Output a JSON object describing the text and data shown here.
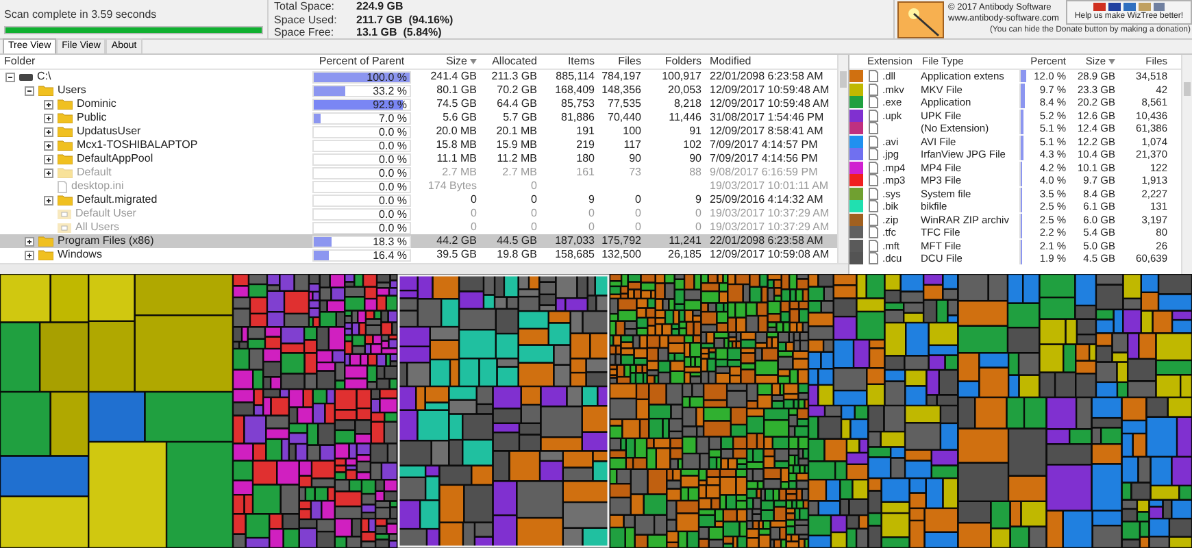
{
  "scan": {
    "status": "Scan complete in 3.59 seconds",
    "level": 1
  },
  "stats": [
    {
      "label": "Total Space:",
      "value": "224.9 GB"
    },
    {
      "label": "Space Used:",
      "value": "211.7 GB  (94.16%)"
    },
    {
      "label": "Space Free:",
      "value": "13.1 GB  (5.84%)"
    }
  ],
  "about": {
    "copyright": "© 2017 Antibody Software",
    "url": "www.antibody-software.com",
    "donate_caption": "Help us make WizTree better!",
    "donate_hint": "(You can hide the Donate button by making a donation)"
  },
  "tabs": [
    {
      "label": "Tree View",
      "selected": true
    },
    {
      "label": "File View",
      "selected": false
    },
    {
      "label": "About",
      "selected": false
    }
  ],
  "tree_columns": [
    {
      "label": "Folder",
      "sorted": false
    },
    {
      "label": "Percent of Parent",
      "sorted": false
    },
    {
      "label": "Size",
      "sorted": true
    },
    {
      "label": "Allocated",
      "sorted": false
    },
    {
      "label": "Items",
      "sorted": false
    },
    {
      "label": "Files",
      "sorted": false
    },
    {
      "label": "Folders",
      "sorted": false
    },
    {
      "label": "Modified",
      "sorted": false
    }
  ],
  "tree": [
    {
      "name": "C:\\",
      "kind": "drive",
      "expanded": true,
      "hidden": false,
      "selected": false,
      "percent": "100.0 %",
      "level": 1,
      "size": "241.4 GB",
      "allocated": "211.3 GB",
      "items": "885,114",
      "files": "784,197",
      "folders": "100,917",
      "modified": "22/01/2098 6:23:58 AM",
      "children": [
        {
          "name": "Users",
          "kind": "folder",
          "expanded": true,
          "hidden": false,
          "selected": false,
          "percent": "33.2 %",
          "level": 0.332,
          "size": "80.1 GB",
          "allocated": "70.2 GB",
          "items": "168,409",
          "files": "148,356",
          "folders": "20,053",
          "modified": "12/09/2017 10:59:48 AM",
          "children": [
            {
              "name": "Dominic",
              "kind": "folder",
              "expanded": false,
              "hidden": false,
              "selected": false,
              "percent": "92.9 %",
              "level": 0.929,
              "size": "74.5 GB",
              "allocated": "64.4 GB",
              "items": "85,753",
              "files": "77,535",
              "folders": "8,218",
              "modified": "12/09/2017 10:59:48 AM"
            },
            {
              "name": "Public",
              "kind": "folder",
              "expanded": false,
              "hidden": false,
              "selected": false,
              "percent": "7.0 %",
              "level": 0.07,
              "size": "5.6 GB",
              "allocated": "5.7 GB",
              "items": "81,886",
              "files": "70,440",
              "folders": "11,446",
              "modified": "31/08/2017 1:54:46 PM"
            },
            {
              "name": "UpdatusUser",
              "kind": "folder",
              "expanded": false,
              "hidden": false,
              "selected": false,
              "percent": "0.0 %",
              "size": "20.0 MB",
              "allocated": "20.1 MB",
              "items": "191",
              "files": "100",
              "folders": "91",
              "modified": "12/09/2017 8:58:41 AM"
            },
            {
              "name": "Mcx1-TOSHIBALAPTOP",
              "kind": "folder",
              "expanded": false,
              "hidden": false,
              "selected": false,
              "percent": "0.0 %",
              "size": "15.8 MB",
              "allocated": "15.9 MB",
              "items": "219",
              "files": "117",
              "folders": "102",
              "modified": "7/09/2017 4:14:57 PM"
            },
            {
              "name": "DefaultAppPool",
              "kind": "folder",
              "expanded": false,
              "hidden": false,
              "selected": false,
              "percent": "0.0 %",
              "size": "11.1 MB",
              "allocated": "11.2 MB",
              "items": "180",
              "files": "90",
              "folders": "90",
              "modified": "7/09/2017 4:14:56 PM"
            },
            {
              "name": "Default",
              "kind": "folder",
              "expanded": false,
              "hidden": true,
              "selected": false,
              "percent": "0.0 %",
              "size": "2.7 MB",
              "allocated": "2.7 MB",
              "items": "161",
              "files": "73",
              "folders": "88",
              "modified": "9/08/2017 6:16:59 PM"
            },
            {
              "name": "desktop.ini",
              "kind": "file",
              "hidden": true,
              "selected": false,
              "percent": "0.0 %",
              "size": "174 Bytes",
              "allocated": "0",
              "modified": "19/03/2017 10:01:11 AM"
            },
            {
              "name": "Default.migrated",
              "kind": "folder",
              "expanded": false,
              "hidden": false,
              "selected": false,
              "percent": "0.0 %",
              "size": "0",
              "allocated": "0",
              "items": "9",
              "files": "0",
              "folders": "9",
              "modified": "25/09/2016 4:14:32 AM"
            },
            {
              "name": "Default User",
              "kind": "link",
              "hidden": true,
              "selected": false,
              "percent": "0.0 %",
              "size": "0",
              "allocated": "0",
              "items": "0",
              "files": "0",
              "folders": "0",
              "modified": "19/03/2017 10:37:29 AM"
            },
            {
              "name": "All Users",
              "kind": "link",
              "hidden": true,
              "selected": false,
              "percent": "0.0 %",
              "size": "0",
              "allocated": "0",
              "items": "0",
              "files": "0",
              "folders": "0",
              "modified": "19/03/2017 10:37:29 AM"
            }
          ]
        },
        {
          "name": "Program Files (x86)",
          "kind": "folder",
          "expanded": false,
          "hidden": false,
          "selected": true,
          "percent": "18.3 %",
          "level": 0.183,
          "size": "44.2 GB",
          "allocated": "44.5 GB",
          "items": "187,033",
          "files": "175,792",
          "folders": "11,241",
          "modified": "22/01/2098 6:23:58 AM"
        },
        {
          "name": "Windows",
          "kind": "folder",
          "expanded": false,
          "hidden": false,
          "selected": false,
          "percent": "16.4 %",
          "level": 0.164,
          "size": "39.5 GB",
          "allocated": "19.8 GB",
          "items": "158,685",
          "files": "132,500",
          "folders": "26,185",
          "modified": "12/09/2017 10:59:08 AM"
        }
      ]
    }
  ],
  "ext_columns": [
    {
      "label": "Extension",
      "sorted": false
    },
    {
      "label": "File Type",
      "sorted": false
    },
    {
      "label": "Percent",
      "sorted": false
    },
    {
      "label": "Size",
      "sorted": true
    },
    {
      "label": "Files",
      "sorted": false
    }
  ],
  "extensions": [
    {
      "color": "#d07010",
      "ext": ".dll",
      "type": "Application extens",
      "percent": "12.0 %",
      "level": 0.12,
      "size": "28.9 GB",
      "files": "34,518"
    },
    {
      "color": "#c0b800",
      "ext": ".mkv",
      "type": "MKV File",
      "percent": "9.7 %",
      "level": 0.097,
      "size": "23.3 GB",
      "files": "42"
    },
    {
      "color": "#20a040",
      "ext": ".exe",
      "type": "Application",
      "percent": "8.4 %",
      "level": 0.084,
      "size": "20.2 GB",
      "files": "8,561"
    },
    {
      "color": "#8030d0",
      "ext": ".upk",
      "type": "UPK File",
      "percent": "5.2 %",
      "level": 0.052,
      "size": "12.6 GB",
      "files": "10,436"
    },
    {
      "color": "#c03080",
      "type": "(No Extension)",
      "percent": "5.1 %",
      "level": 0.051,
      "size": "12.4 GB",
      "files": "61,386"
    },
    {
      "color": "#2090f0",
      "ext": ".avi",
      "type": "AVI File",
      "percent": "5.1 %",
      "level": 0.051,
      "size": "12.2 GB",
      "files": "1,074"
    },
    {
      "color": "#7070f0",
      "ext": ".jpg",
      "type": "IrfanView JPG File",
      "percent": "4.3 %",
      "level": 0.043,
      "size": "10.4 GB",
      "files": "21,370"
    },
    {
      "color": "#d020d0",
      "ext": ".mp4",
      "type": "MP4 File",
      "percent": "4.2 %",
      "level": 0.042,
      "size": "10.1 GB",
      "files": "122"
    },
    {
      "color": "#f02020",
      "ext": ".mp3",
      "type": "MP3 File",
      "percent": "4.0 %",
      "level": 0.04,
      "size": "9.7 GB",
      "files": "1,913"
    },
    {
      "color": "#70a030",
      "ext": ".sys",
      "type": "System file",
      "percent": "3.5 %",
      "level": 0.035,
      "size": "8.4 GB",
      "files": "2,227"
    },
    {
      "color": "#20e0b0",
      "ext": ".bik",
      "type": "bikfile",
      "percent": "2.5 %",
      "level": 0.025,
      "size": "6.1 GB",
      "files": "131"
    },
    {
      "color": "#a06020",
      "ext": ".zip",
      "type": "WinRAR ZIP archiv",
      "percent": "2.5 %",
      "level": 0.025,
      "size": "6.0 GB",
      "files": "3,197"
    },
    {
      "color": "#606060",
      "ext": ".tfc",
      "type": "TFC File",
      "percent": "2.2 %",
      "level": 0.022,
      "size": "5.4 GB",
      "files": "80"
    },
    {
      "color": "#5a5a5a",
      "ext": ".mft",
      "type": "MFT File",
      "percent": "2.1 %",
      "level": 0.021,
      "size": "5.0 GB",
      "files": "26"
    },
    {
      "color": "#545454",
      "ext": ".dcu",
      "type": "DCU File",
      "percent": "1.9 %",
      "level": 0.019,
      "size": "4.5 GB",
      "files": "60,639"
    }
  ]
}
